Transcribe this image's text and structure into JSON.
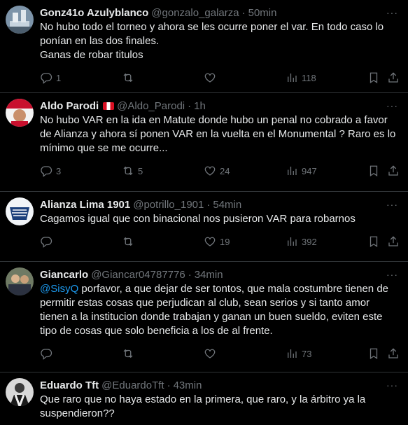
{
  "tweets": [
    {
      "name": "Gonz41o Azulyblanco",
      "handle": "@gonzalo_galarza",
      "time": "50min",
      "text": "No hubo todo el torneo y ahora se les ocurre poner el var.  En todo caso lo ponían en las dos finales.\nGanas de robar titulos",
      "replies": "1",
      "retweets": "",
      "likes": "",
      "views": "118"
    },
    {
      "name": "Aldo Parodi",
      "handle": "@Aldo_Parodi",
      "time": "1h",
      "text": "No hubo VAR en la ida en Matute donde hubo un penal no cobrado a favor de Alianza y ahora sí ponen VAR en la vuelta en el Monumental ? Raro es lo mínimo que se me ocurre...",
      "replies": "3",
      "retweets": "5",
      "likes": "24",
      "views": "947"
    },
    {
      "name": "Alianza Lima 1901",
      "handle": "@potrillo_1901",
      "time": "54min",
      "text": "Cagamos igual que con binacional nos pusieron VAR para robarnos",
      "replies": "",
      "retweets": "",
      "likes": "19",
      "views": "392"
    },
    {
      "name": "Giancarlo",
      "handle": "@Giancar04787776",
      "time": "34min",
      "mention": "@SisyQ",
      "text": " porfavor, a que dejar de ser tontos, que mala costumbre tienen de permitir estas cosas que perjudican al club, sean serios y si tanto amor tienen a la institucion donde trabajan y ganan un buen sueldo, eviten este tipo de cosas que solo beneficia a los de al frente.",
      "replies": "",
      "retweets": "",
      "likes": "",
      "views": "73"
    },
    {
      "name": "Eduardo Tft",
      "handle": "@EduardoTft",
      "time": "43min",
      "text": "Que raro que no haya estado en la primera, que raro, y la árbitro ya la suspendieron??"
    }
  ],
  "separator": "·",
  "more_glyph": "···",
  "colors": {
    "background": "#000000",
    "text": "#e7e9ea",
    "muted": "#71767b",
    "link": "#1d9bf0",
    "divider": "#2f3336"
  }
}
